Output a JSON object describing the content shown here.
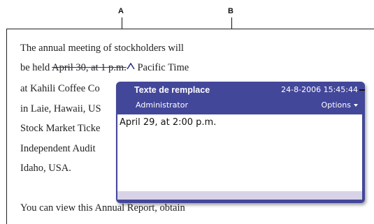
{
  "callouts": {
    "a": "A",
    "b": "B"
  },
  "document": {
    "lines": [
      "The annual meeting of stockholders will",
      "at Kahili Coffee Co",
      "in Laie, Hawaii, US",
      "Stock Market Ticke",
      "Independent Audit",
      "Idaho, USA.",
      "You can view this Annual Report, obtain"
    ],
    "line2_prefix": "be held ",
    "line2_struck": "April 30, at 1 p.m.",
    "line2_suffix": " Pacific Time"
  },
  "note": {
    "title": "Texte de remplace",
    "date": "24-8-2006 15:45:44",
    "author": "Administrator",
    "options_label": "Options",
    "body_text": "April 29, at 2:00 p.m."
  },
  "colors": {
    "popup_header": "#43479a",
    "popup_footer": "#d9d3e8",
    "strike_color": "#2a2a7a"
  }
}
